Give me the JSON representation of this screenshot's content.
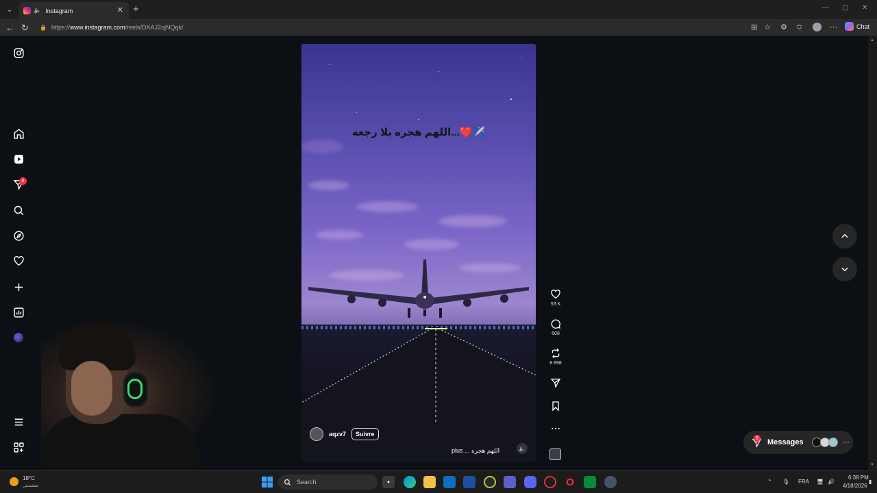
{
  "browser": {
    "tab_title": "Instagram",
    "url_prefix": "https://",
    "url_domain": "www.instagram.com",
    "url_path": "/reels/DXAJ2ojNQqk/",
    "chat_label": "Chat"
  },
  "sidebar": {
    "notifications_badge": "8"
  },
  "reel": {
    "overlay_text": "اللهم هجره بلا رجعه...❤️✈️",
    "author": "aqzv7",
    "follow_label": "Suivre",
    "caption": "plus ... اللهم هجره"
  },
  "actions": {
    "likes": "53 K",
    "comments": "608",
    "reposts": "8 898"
  },
  "messages": {
    "label": "Messages",
    "badge": "8"
  },
  "taskbar": {
    "weather_temp": "18°C",
    "weather_desc": "مشمس",
    "search_placeholder": "Search",
    "language": "FRA",
    "time": "6:38 PM",
    "date": "4/18/2026"
  },
  "colors": {
    "background": "#0c1014",
    "badge": "#ff3040",
    "accent": "#ffffff"
  }
}
